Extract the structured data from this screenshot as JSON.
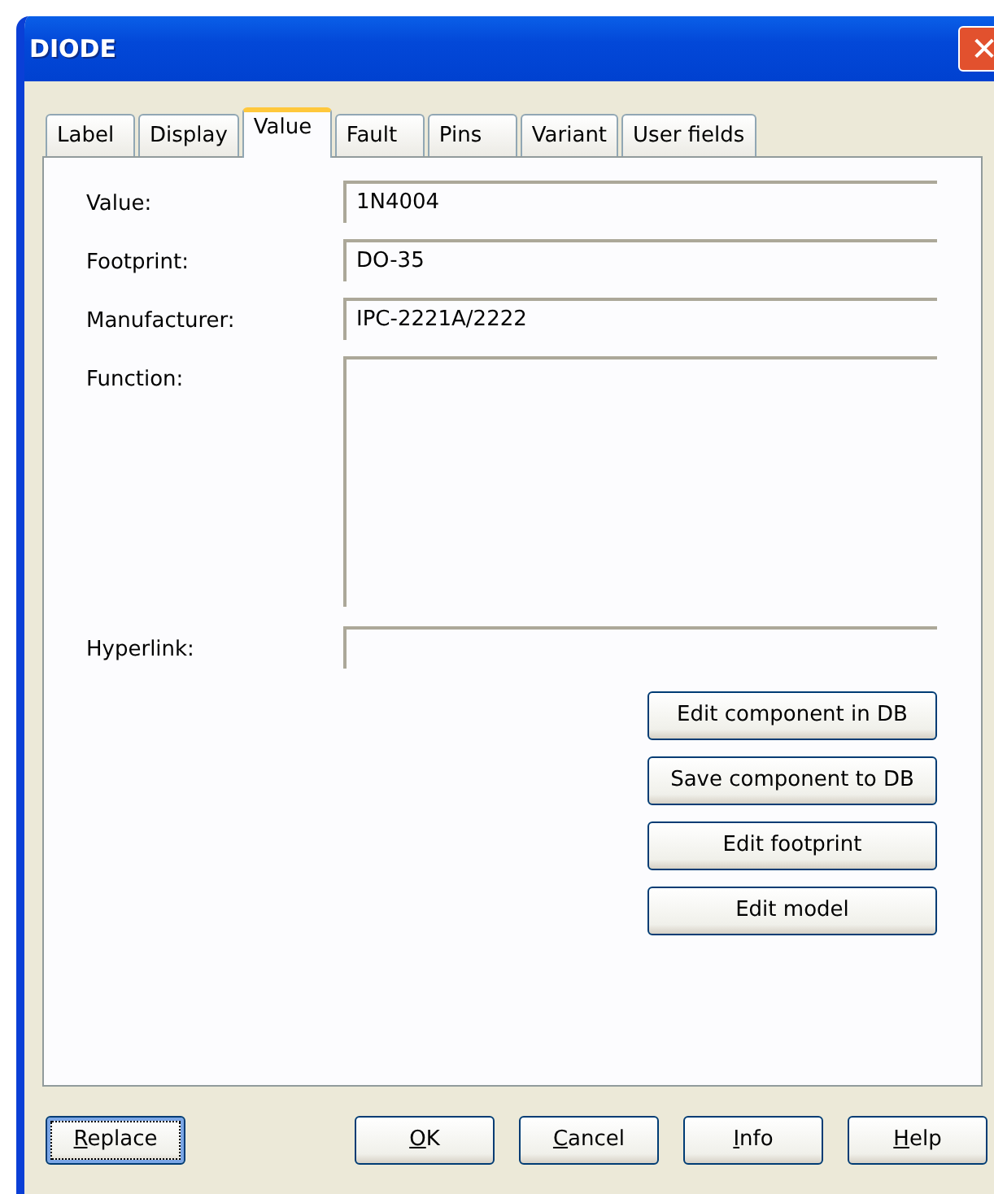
{
  "window": {
    "title": "DIODE",
    "close_glyph": "✕"
  },
  "tabs": [
    {
      "label": "Label",
      "selected": false
    },
    {
      "label": "Display",
      "selected": false
    },
    {
      "label": "Value",
      "selected": true
    },
    {
      "label": "Fault",
      "selected": false
    },
    {
      "label": "Pins",
      "selected": false
    },
    {
      "label": "Variant",
      "selected": false
    },
    {
      "label": "User fields",
      "selected": false
    }
  ],
  "fields": [
    {
      "label": "Value:",
      "value": "1N4004",
      "kind": "line"
    },
    {
      "label": "Footprint:",
      "value": "DO-35",
      "kind": "line"
    },
    {
      "label": "Manufacturer:",
      "value": "IPC-2221A/2222",
      "kind": "line"
    },
    {
      "label": "Function:",
      "kind": "area"
    },
    {
      "label": "Hyperlink:",
      "kind": "line"
    }
  ],
  "side_buttons": [
    "Edit component in DB",
    "Save component to DB",
    "Edit footprint",
    "Edit model"
  ],
  "bottom_buttons": [
    {
      "mnemonic": "R",
      "rest": "eplace",
      "focused": true
    },
    {
      "mnemonic": "O",
      "rest": "K",
      "focused": false
    },
    {
      "mnemonic": "C",
      "rest": "ancel",
      "focused": false
    },
    {
      "mnemonic": "I",
      "rest": "nfo",
      "focused": false
    },
    {
      "mnemonic": "H",
      "rest": "elp",
      "focused": false
    }
  ]
}
